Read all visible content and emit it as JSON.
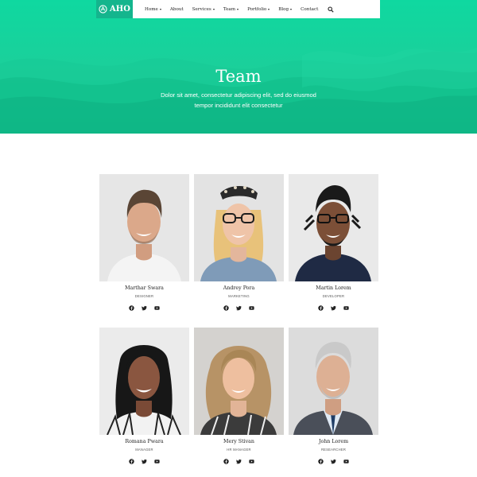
{
  "brand": {
    "name": "AHO"
  },
  "nav": {
    "items": [
      {
        "label": "Home",
        "dropdown": true
      },
      {
        "label": "About",
        "dropdown": false
      },
      {
        "label": "Services",
        "dropdown": true
      },
      {
        "label": "Team",
        "dropdown": true
      },
      {
        "label": "Portfolio",
        "dropdown": true
      },
      {
        "label": "Blog",
        "dropdown": true
      },
      {
        "label": "Contact",
        "dropdown": false
      }
    ],
    "search_icon": "search-icon"
  },
  "hero": {
    "title": "Team",
    "subtitle_line1": "Dolor sit amet, consectetur adipiscing elit, sed do eiusmod",
    "subtitle_line2": "tempor incididunt elit consectetur"
  },
  "team": [
    {
      "name": "Marthar Swara",
      "role": "DESIGNER"
    },
    {
      "name": "Andrey Pora",
      "role": "MARKETING"
    },
    {
      "name": "Martin Lorem",
      "role": "DEVELOPER"
    },
    {
      "name": "Romana Pwara",
      "role": "MANAGER"
    },
    {
      "name": "Mery Stivan",
      "role": "HR MANAGER"
    },
    {
      "name": "John Lorem",
      "role": "RESEARCHER"
    }
  ],
  "social_icons": [
    "facebook-icon",
    "twitter-icon",
    "youtube-icon"
  ],
  "colors": {
    "accent": "#14b58d",
    "hero_gradient_top": "#0fd8a0",
    "hero_gradient_bottom": "#12c28f",
    "text_dark": "#222222"
  }
}
